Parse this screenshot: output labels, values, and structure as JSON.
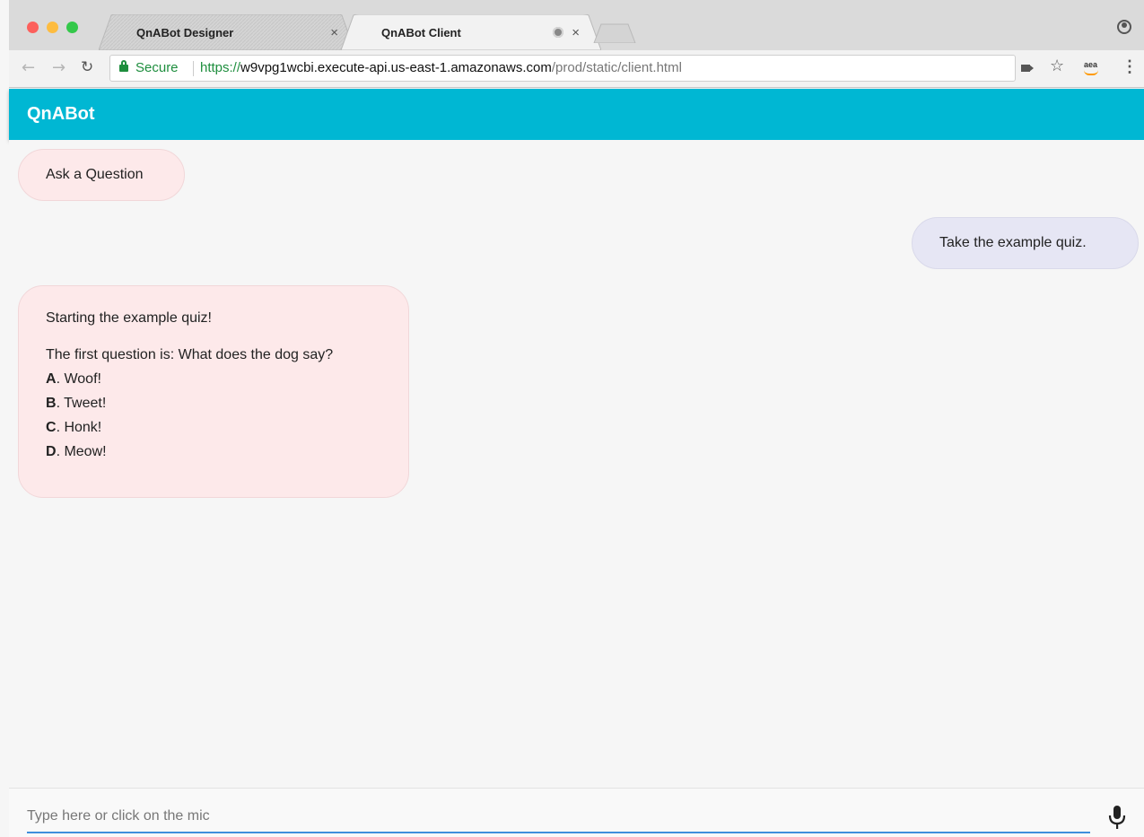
{
  "browser": {
    "tabs": [
      {
        "title": "QnABot Designer",
        "active": false
      },
      {
        "title": "QnABot Client",
        "active": true
      }
    ],
    "security_label": "Secure",
    "url": {
      "scheme": "https://",
      "host": "w9vpg1wcbi.execute-api.us-east-1.amazonaws.com",
      "path": "/prod/static/client.html"
    },
    "icons": [
      "back-icon",
      "forward-icon",
      "reload-icon",
      "lock-icon",
      "camera-icon",
      "star-icon",
      "amazon-assistant-icon",
      "menu-icon",
      "profile-icon"
    ]
  },
  "app": {
    "title": "QnABot",
    "accent_color": "#00b7d3"
  },
  "messages": {
    "ask": "Ask a Question",
    "take": "Take the example quiz.",
    "quiz": {
      "intro": "Starting the example quiz!",
      "question": "The first question is: What does the dog say?",
      "options": [
        {
          "letter": "A",
          "text": ". Woof!"
        },
        {
          "letter": "B",
          "text": ". Tweet!"
        },
        {
          "letter": "C",
          "text": ". Honk!"
        },
        {
          "letter": "D",
          "text": ". Meow!"
        }
      ]
    }
  },
  "input": {
    "placeholder": "Type here or click on the mic",
    "mic_icon": "microphone-icon"
  }
}
